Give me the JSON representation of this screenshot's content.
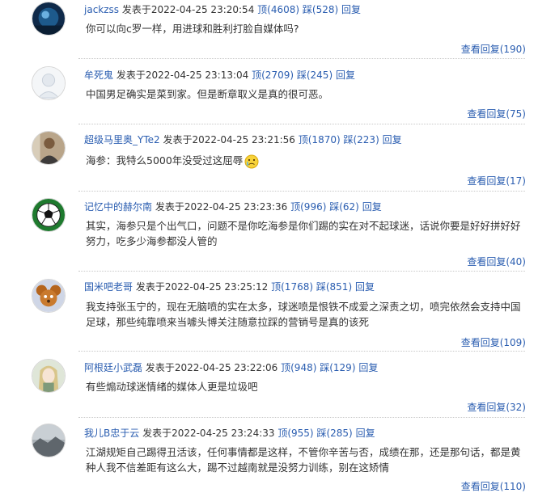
{
  "comments": [
    {
      "user": "jackzss",
      "posted": "发表于2022-04-25 23:20:54",
      "up": "顶(4608)",
      "down": "踩(528)",
      "reply": "回复",
      "text": "你可以向c罗一样，用进球和胜利打脸自媒体吗?",
      "view": "查看回复(190)",
      "avatar": "blue-night-avatar"
    },
    {
      "user": "牟死鬼",
      "posted": "发表于2022-04-25 23:13:04",
      "up": "顶(2709)",
      "down": "踩(245)",
      "reply": "回复",
      "text": "中国男足确实是菜到家。但是断章取义是真的很可恶。",
      "view": "查看回复(75)",
      "avatar": "sketch-avatar"
    },
    {
      "user": "超级马里奥_YTe2",
      "posted": "发表于2022-04-25 23:21:56",
      "up": "顶(1870)",
      "down": "踩(223)",
      "reply": "回复",
      "text": "海参：我特么5000年没受过这屈辱",
      "view": "查看回复(17)",
      "avatar": "person-photo-avatar",
      "emoji": "crying-face-emoji"
    },
    {
      "user": "记忆中的赫尔南",
      "posted": "发表于2022-04-25 23:23:36",
      "up": "顶(996)",
      "down": "踩(62)",
      "reply": "回复",
      "text": "其实，海参只是个出气口，问题不是你吃海参是你们踢的实在对不起球迷，话说你要是好好拼好好努力，吃多少海参都没人管的",
      "view": "查看回复(40)",
      "avatar": "soccer-ball-avatar"
    },
    {
      "user": "国米吧老哥",
      "posted": "发表于2022-04-25 23:25:12",
      "up": "顶(1768)",
      "down": "踩(851)",
      "reply": "回复",
      "text": "我支持张玉宁的，现在无脑喷的实在太多，球迷喷是恨铁不成爱之深责之切，喷完依然会支持中国足球，那些纯靠喷来当噱头博关注随意拉踩的营销号是真的该死",
      "view": "查看回复(109)",
      "avatar": "cartoon-mouse-avatar"
    },
    {
      "user": "阿根廷小武磊",
      "posted": "发表于2022-04-25 23:22:06",
      "up": "顶(948)",
      "down": "踩(129)",
      "reply": "回复",
      "text": "有些煽动球迷情绪的媒体人更是垃圾吧",
      "view": "查看回复(32)",
      "avatar": "anime-girl-avatar"
    },
    {
      "user": "我儿B忠于云",
      "posted": "发表于2022-04-25 23:24:33",
      "up": "顶(955)",
      "down": "踩(285)",
      "reply": "回复",
      "text": "江湖规矩自己踢得丑活该，任何事情都是这样，不管你辛苦与否，成绩在那，还是那句话，都是黄种人我不信差距有这么大，踢不过越南就是没努力训练，别在这矫情",
      "view": "查看回复(110)",
      "avatar": "gray-landscape-avatar"
    }
  ]
}
